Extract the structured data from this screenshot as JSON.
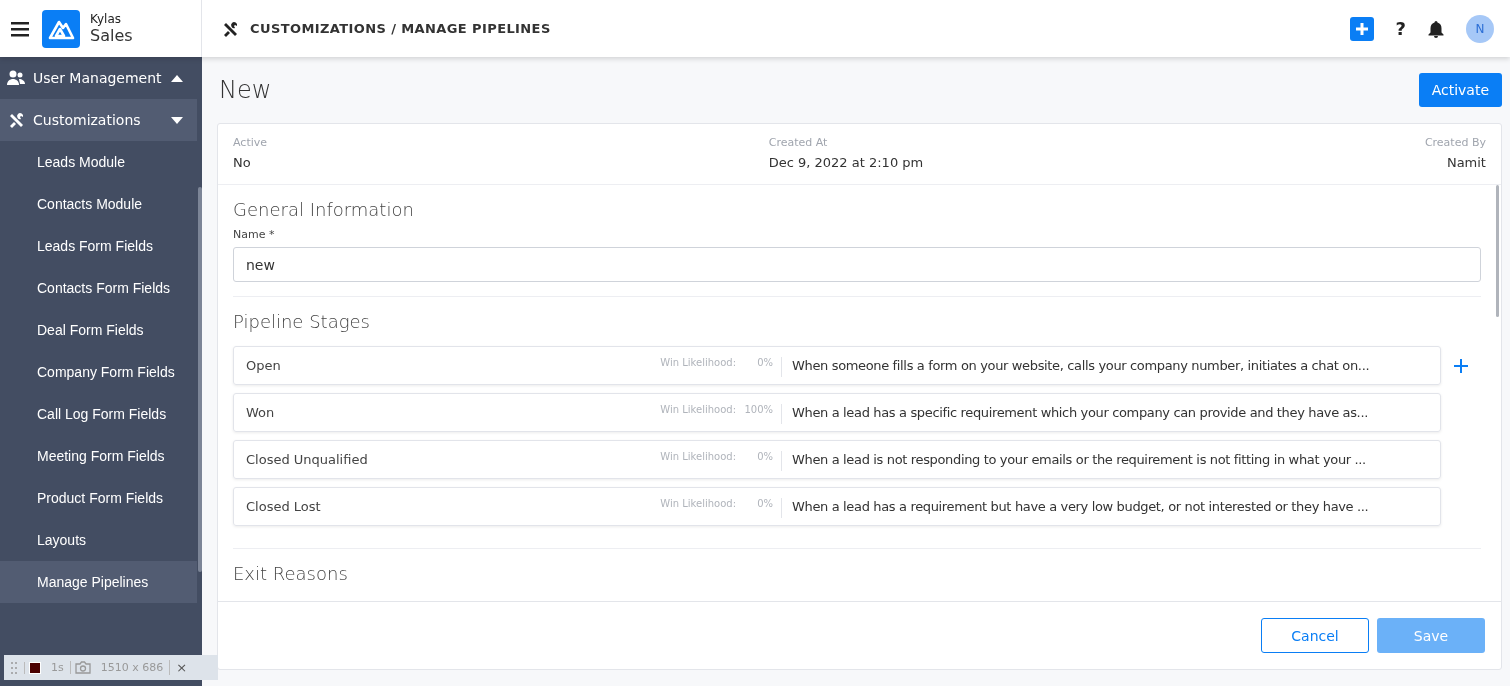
{
  "header": {
    "brand_top": "Kylas",
    "brand_bottom": "Sales",
    "breadcrumb": "CUSTOMIZATIONS / MANAGE PIPELINES",
    "avatar": "N",
    "help": "?"
  },
  "sidebar": {
    "items": [
      {
        "label": "User Management",
        "expanded": false
      },
      {
        "label": "Customizations",
        "expanded": true,
        "children": [
          {
            "label": "Leads Module",
            "selected": false
          },
          {
            "label": "Contacts Module",
            "selected": false
          },
          {
            "label": "Leads Form Fields",
            "selected": false
          },
          {
            "label": "Contacts Form Fields",
            "selected": false
          },
          {
            "label": "Deal Form Fields",
            "selected": false
          },
          {
            "label": "Company Form Fields",
            "selected": false
          },
          {
            "label": "Call Log Form Fields",
            "selected": false
          },
          {
            "label": "Meeting Form Fields",
            "selected": false
          },
          {
            "label": "Product Form Fields",
            "selected": false
          },
          {
            "label": "Layouts",
            "selected": false
          },
          {
            "label": "Manage Pipelines",
            "selected": true
          }
        ]
      }
    ]
  },
  "page": {
    "title": "New",
    "activate_button": "Activate"
  },
  "summary": [
    {
      "label": "Active",
      "value": "No"
    },
    {
      "label": "Created At",
      "value": "Dec 9, 2022 at 2:10 pm"
    },
    {
      "label": "Created By",
      "value": "Namit"
    }
  ],
  "general": {
    "heading": "General Information",
    "name_label": "Name *",
    "name_value": "new"
  },
  "stages": {
    "heading": "Pipeline Stages",
    "items": [
      {
        "name": "Open",
        "likelihood_label": "Win Likelihood:",
        "likelihood": "0%",
        "description": "When someone fills a form on your website, calls your company number, initiates a chat on..."
      },
      {
        "name": "Won",
        "likelihood_label": "Win Likelihood:",
        "likelihood": "100%",
        "description": "When a lead has a specific requirement which your company can provide and they have as..."
      },
      {
        "name": "Closed Unqualified",
        "likelihood_label": "Win Likelihood:",
        "likelihood": "0%",
        "description": "When a lead is not responding to your emails or the requirement is not fitting in what your ..."
      },
      {
        "name": "Closed Lost",
        "likelihood_label": "Win Likelihood:",
        "likelihood": "0%",
        "description": "When a lead has a requirement but have a very low budget, or not interested or they have ..."
      }
    ]
  },
  "exit_heading": "Exit Reasons",
  "footer": {
    "buttons": [
      {
        "label": "Cancel",
        "kind": "secondary",
        "disabled": false
      },
      {
        "label": "Save",
        "kind": "primary",
        "disabled": true
      }
    ]
  },
  "recorder": {
    "interval": "1s",
    "size": "1510 x 686",
    "close": "×"
  }
}
